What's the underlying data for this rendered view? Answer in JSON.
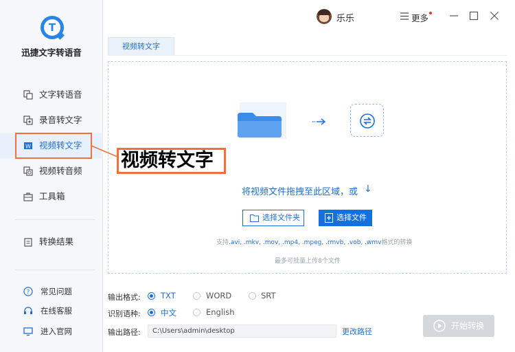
{
  "app": {
    "name": "迅捷文字转语音",
    "logo_letter": "T"
  },
  "sidebar": {
    "items": [
      {
        "label": "文字转语音",
        "icon": "text-to-speech-icon"
      },
      {
        "label": "录音转文字",
        "icon": "recording-icon"
      },
      {
        "label": "视频转文字",
        "icon": "video-icon",
        "active": true
      },
      {
        "label": "视频转音频",
        "icon": "video-audio-icon"
      },
      {
        "label": "工具箱",
        "icon": "toolbox-icon"
      },
      {
        "label": "转换结果",
        "icon": "clipboard-icon"
      }
    ],
    "footer": [
      {
        "label": "常见问题",
        "icon": "help-icon"
      },
      {
        "label": "在线客服",
        "icon": "headset-icon"
      },
      {
        "label": "进入官网",
        "icon": "monitor-icon"
      }
    ]
  },
  "header": {
    "username": "乐乐",
    "more_label": "更多"
  },
  "tab": {
    "label": "视频转文字"
  },
  "dropzone": {
    "prompt": "将视频文件拖拽至此区域，或",
    "arrow": "↓",
    "select_folder": "选择文件夹",
    "select_file": "选择文件",
    "support_prefix": "支持",
    "support_formats": ".avi, .mkv, .mov, .mp4, .mpeg, .rmvb, .vob, .wmv",
    "support_suffix": "格式的转换",
    "max_note": "最多可批量上传8个文件"
  },
  "options": {
    "format_label": "输出格式:",
    "formats": [
      "TXT",
      "WORD",
      "SRT"
    ],
    "selected_format": "TXT",
    "language_label": "识别语种:",
    "languages": [
      "中文",
      "English"
    ],
    "selected_language": "中文",
    "path_label": "输出路径:",
    "path_value": "C:\\Users\\admin\\desktop",
    "change_path": "更改路径"
  },
  "start_button": "开始转换",
  "callout": {
    "text": "视频转文字"
  },
  "colors": {
    "accent": "#1570dc",
    "highlight": "#f0703a",
    "disabled": "#d4d7dc"
  }
}
